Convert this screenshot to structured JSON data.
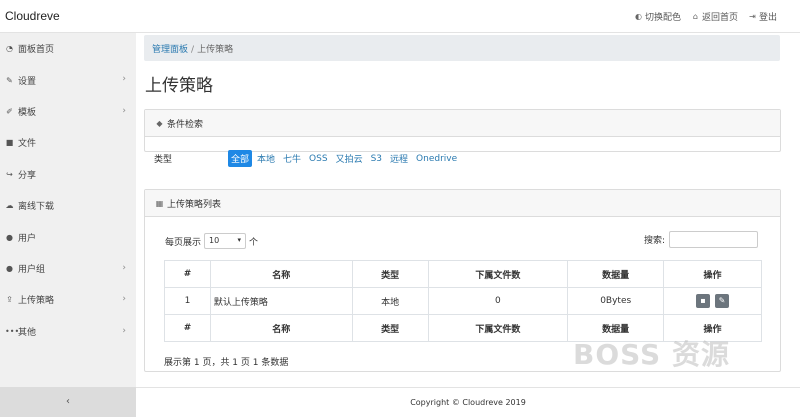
{
  "app": {
    "title": "Cloudreve"
  },
  "topbar": {
    "actions": [
      {
        "icon": "toggle-icon",
        "label": "切换配色"
      },
      {
        "icon": "home-icon",
        "label": "返回首页"
      },
      {
        "icon": "logout-icon",
        "label": "登出"
      }
    ]
  },
  "sidebar": {
    "items": [
      {
        "icon": "dashboard-icon",
        "label": "面板首页",
        "chevron": false
      },
      {
        "icon": "wrench-icon",
        "label": "设置",
        "chevron": true
      },
      {
        "icon": "brush-icon",
        "label": "模板",
        "chevron": true
      },
      {
        "icon": "folder-icon",
        "label": "文件",
        "chevron": false
      },
      {
        "icon": "share-icon",
        "label": "分享",
        "chevron": false
      },
      {
        "icon": "cloud-download-icon",
        "label": "离线下载",
        "chevron": false
      },
      {
        "icon": "user-icon",
        "label": "用户",
        "chevron": false
      },
      {
        "icon": "users-icon",
        "label": "用户组",
        "chevron": true
      },
      {
        "icon": "upload-icon",
        "label": "上传策略",
        "chevron": true
      },
      {
        "icon": "ellipsis-icon",
        "label": "其他",
        "chevron": true
      }
    ],
    "collapse_label": "‹"
  },
  "breadcrumb": {
    "parent": "管理面板",
    "separator": "/",
    "current": "上传策略"
  },
  "page": {
    "title": "上传策略"
  },
  "filter": {
    "header": "条件检索",
    "label": "类型",
    "options": [
      "全部",
      "本地",
      "七牛",
      "OSS",
      "又拍云",
      "S3",
      "远程",
      "Onedrive"
    ],
    "selected": "全部"
  },
  "list": {
    "header": "上传策略列表",
    "per_page_prefix": "每页展示",
    "per_page_value": "10",
    "per_page_suffix": "个",
    "search_label": "搜索:",
    "columns": [
      "#",
      "名称",
      "类型",
      "下属文件数",
      "数据量",
      "操作"
    ],
    "rows": [
      {
        "id": "1",
        "name": "默认上传策略",
        "type": "本地",
        "files": "0",
        "size": "0Bytes"
      }
    ],
    "page_info": "展示第 1 页，共 1 页 1 条数据"
  },
  "footer": {
    "text": "Copyright © Cloudreve 2019"
  },
  "watermark": "BOSS 资源",
  "colors": {
    "accent": "#1e88e5",
    "link": "#2a7ab0",
    "button": "#6c757d"
  }
}
